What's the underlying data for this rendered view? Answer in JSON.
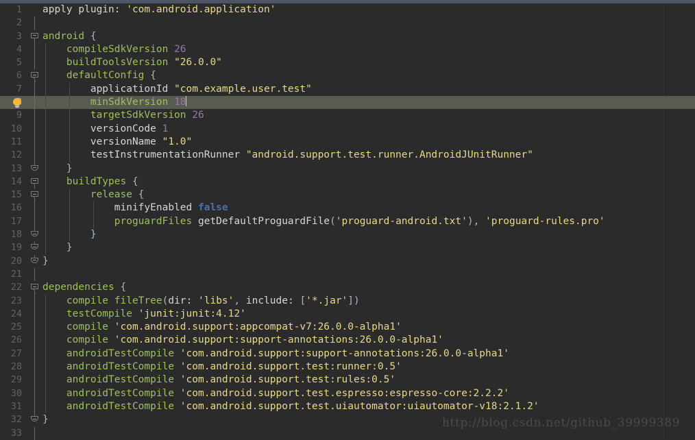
{
  "app": {
    "name": "android-studio-code-editor",
    "theme": "Darcula",
    "file_language": "Groovy / Gradle"
  },
  "colors": {
    "background": "#2b2b2b",
    "gutter_background": "#2b2b2b",
    "line_number": "#606366",
    "line_number_current": "#a4a4a4",
    "current_line_highlight": "#585b50",
    "top_strip": "#4e5665",
    "identifier_green": "#9fbf60",
    "string_yellow": "#e8d98a",
    "number_purple": "#9876aa",
    "keyword_blue": "#4b6eaf",
    "plain_text": "#a9b7c6",
    "white_text": "#d6d6d6",
    "fold_marker": "#7a7a78",
    "indent_guide": "#4a4a48",
    "bulb_yellow": "#f2b63c",
    "watermark": "#4a4a48",
    "margin_guide": "#323232"
  },
  "gutter": {
    "intention_bulb_line": 8,
    "intention_bulb_icon": "lightbulb-icon",
    "first_line": 1,
    "last_line": 33
  },
  "editor": {
    "current_line": 8,
    "caret_line": 8,
    "caret_column": 25
  },
  "watermark": {
    "text": "http://blog.csdn.net/github_39999389"
  },
  "lines": [
    {
      "n": 1,
      "fold": "none",
      "indent_guides": [],
      "tokens": [
        {
          "t": "apply plugin: ",
          "c": "t-white"
        },
        {
          "t": "'com.android.application'",
          "c": "t-str"
        }
      ]
    },
    {
      "n": 2,
      "fold": "rail",
      "indent_guides": [],
      "tokens": []
    },
    {
      "n": 3,
      "fold": "open",
      "indent_guides": [],
      "tokens": [
        {
          "t": "android",
          "c": "t-ident"
        },
        {
          "t": " {",
          "c": "t-brace"
        }
      ]
    },
    {
      "n": 4,
      "fold": "rail",
      "indent_guides": [
        0
      ],
      "tokens": [
        {
          "t": "    compileSdkVersion ",
          "c": "t-ident"
        },
        {
          "t": "26",
          "c": "t-num"
        }
      ]
    },
    {
      "n": 5,
      "fold": "rail",
      "indent_guides": [
        0
      ],
      "tokens": [
        {
          "t": "    buildToolsVersion ",
          "c": "t-ident"
        },
        {
          "t": "\"26.0.0\"",
          "c": "t-str"
        }
      ]
    },
    {
      "n": 6,
      "fold": "open",
      "indent_guides": [
        0
      ],
      "tokens": [
        {
          "t": "    defaultConfig",
          "c": "t-ident"
        },
        {
          "t": " {",
          "c": "t-brace"
        }
      ]
    },
    {
      "n": 7,
      "fold": "rail",
      "indent_guides": [
        0,
        1
      ],
      "tokens": [
        {
          "t": "        applicationId ",
          "c": "t-white"
        },
        {
          "t": "\"com.example.user.test\"",
          "c": "t-str"
        }
      ]
    },
    {
      "n": 8,
      "fold": "rail",
      "current": true,
      "bulb": true,
      "indent_guides": [
        0,
        1
      ],
      "tokens": [
        {
          "t": "        minSdkVersion ",
          "c": "t-ident"
        },
        {
          "t": "18",
          "c": "t-num"
        }
      ],
      "caret": true
    },
    {
      "n": 9,
      "fold": "rail",
      "indent_guides": [
        0,
        1
      ],
      "tokens": [
        {
          "t": "        targetSdkVersion ",
          "c": "t-ident"
        },
        {
          "t": "26",
          "c": "t-num"
        }
      ]
    },
    {
      "n": 10,
      "fold": "rail",
      "indent_guides": [
        0,
        1
      ],
      "tokens": [
        {
          "t": "        versionCode ",
          "c": "t-white"
        },
        {
          "t": "1",
          "c": "t-num"
        }
      ]
    },
    {
      "n": 11,
      "fold": "rail",
      "indent_guides": [
        0,
        1
      ],
      "tokens": [
        {
          "t": "        versionName ",
          "c": "t-white"
        },
        {
          "t": "\"1.0\"",
          "c": "t-str"
        }
      ]
    },
    {
      "n": 12,
      "fold": "rail",
      "indent_guides": [
        0,
        1
      ],
      "tokens": [
        {
          "t": "        testInstrumentationRunner ",
          "c": "t-white"
        },
        {
          "t": "\"android.support.test.runner.AndroidJUnitRunner\"",
          "c": "t-str"
        }
      ]
    },
    {
      "n": 13,
      "fold": "close",
      "indent_guides": [
        0
      ],
      "tokens": [
        {
          "t": "    }",
          "c": "t-brace"
        }
      ]
    },
    {
      "n": 14,
      "fold": "open",
      "indent_guides": [
        0
      ],
      "tokens": [
        {
          "t": "    buildTypes",
          "c": "t-ident"
        },
        {
          "t": " {",
          "c": "t-brace"
        }
      ]
    },
    {
      "n": 15,
      "fold": "open",
      "indent_guides": [
        0,
        1
      ],
      "tokens": [
        {
          "t": "        release",
          "c": "t-ident"
        },
        {
          "t": " {",
          "c": "t-brace"
        }
      ]
    },
    {
      "n": 16,
      "fold": "rail",
      "indent_guides": [
        0,
        1,
        2
      ],
      "tokens": [
        {
          "t": "            minifyEnabled ",
          "c": "t-white"
        },
        {
          "t": "false",
          "c": "t-kw"
        }
      ]
    },
    {
      "n": 17,
      "fold": "rail",
      "indent_guides": [
        0,
        1,
        2
      ],
      "tokens": [
        {
          "t": "            proguardFiles ",
          "c": "t-ident"
        },
        {
          "t": "getDefaultProguardFile",
          "c": "t-white"
        },
        {
          "t": "(",
          "c": "t-punct"
        },
        {
          "t": "'proguard-android.txt'",
          "c": "t-str"
        },
        {
          "t": "), ",
          "c": "t-punct"
        },
        {
          "t": "'proguard-rules.pro'",
          "c": "t-str"
        }
      ]
    },
    {
      "n": 18,
      "fold": "close",
      "indent_guides": [
        0,
        1
      ],
      "tokens": [
        {
          "t": "        }",
          "c": "t-brace"
        }
      ]
    },
    {
      "n": 19,
      "fold": "close",
      "indent_guides": [
        0
      ],
      "tokens": [
        {
          "t": "    }",
          "c": "t-brace"
        }
      ]
    },
    {
      "n": 20,
      "fold": "close",
      "indent_guides": [],
      "tokens": [
        {
          "t": "}",
          "c": "t-brace"
        }
      ]
    },
    {
      "n": 21,
      "fold": "rail",
      "indent_guides": [],
      "tokens": []
    },
    {
      "n": 22,
      "fold": "open",
      "indent_guides": [],
      "tokens": [
        {
          "t": "dependencies",
          "c": "t-ident"
        },
        {
          "t": " {",
          "c": "t-brace"
        }
      ]
    },
    {
      "n": 23,
      "fold": "rail",
      "indent_guides": [
        0
      ],
      "tokens": [
        {
          "t": "    compile ",
          "c": "t-ident"
        },
        {
          "t": "fileTree",
          "c": "t-ident"
        },
        {
          "t": "(",
          "c": "t-punct"
        },
        {
          "t": "dir: ",
          "c": "t-white"
        },
        {
          "t": "'libs'",
          "c": "t-str"
        },
        {
          "t": ", ",
          "c": "t-punct"
        },
        {
          "t": "include: ",
          "c": "t-white"
        },
        {
          "t": "[",
          "c": "t-punct"
        },
        {
          "t": "'*.jar'",
          "c": "t-str"
        },
        {
          "t": "])",
          "c": "t-punct"
        }
      ]
    },
    {
      "n": 24,
      "fold": "rail",
      "indent_guides": [
        0
      ],
      "tokens": [
        {
          "t": "    testCompile ",
          "c": "t-ident"
        },
        {
          "t": "'junit:junit:4.12'",
          "c": "t-str"
        }
      ]
    },
    {
      "n": 25,
      "fold": "rail",
      "indent_guides": [
        0
      ],
      "tokens": [
        {
          "t": "    compile ",
          "c": "t-ident"
        },
        {
          "t": "'com.android.support:appcompat-v7:26.0.0-alpha1'",
          "c": "t-str"
        }
      ]
    },
    {
      "n": 26,
      "fold": "rail",
      "indent_guides": [
        0
      ],
      "tokens": [
        {
          "t": "    compile ",
          "c": "t-ident"
        },
        {
          "t": "'com.android.support:support-annotations:26.0.0-alpha1'",
          "c": "t-str"
        }
      ]
    },
    {
      "n": 27,
      "fold": "rail",
      "indent_guides": [
        0
      ],
      "tokens": [
        {
          "t": "    androidTestCompile ",
          "c": "t-ident"
        },
        {
          "t": "'com.android.support:support-annotations:26.0.0-alpha1'",
          "c": "t-str"
        }
      ]
    },
    {
      "n": 28,
      "fold": "rail",
      "indent_guides": [
        0
      ],
      "tokens": [
        {
          "t": "    androidTestCompile ",
          "c": "t-ident"
        },
        {
          "t": "'com.android.support.test:runner:0.5'",
          "c": "t-str"
        }
      ]
    },
    {
      "n": 29,
      "fold": "rail",
      "indent_guides": [
        0
      ],
      "tokens": [
        {
          "t": "    androidTestCompile ",
          "c": "t-ident"
        },
        {
          "t": "'com.android.support.test:rules:0.5'",
          "c": "t-str"
        }
      ]
    },
    {
      "n": 30,
      "fold": "rail",
      "indent_guides": [
        0
      ],
      "tokens": [
        {
          "t": "    androidTestCompile ",
          "c": "t-ident"
        },
        {
          "t": "'com.android.support.test.espresso:espresso-core:2.2.2'",
          "c": "t-str"
        }
      ]
    },
    {
      "n": 31,
      "fold": "rail",
      "indent_guides": [
        0
      ],
      "tokens": [
        {
          "t": "    androidTestCompile ",
          "c": "t-ident"
        },
        {
          "t": "'com.android.support.test.uiautomator:uiautomator-v18:2.1.2'",
          "c": "t-str"
        }
      ]
    },
    {
      "n": 32,
      "fold": "close",
      "indent_guides": [],
      "tokens": [
        {
          "t": "}",
          "c": "t-brace"
        }
      ]
    },
    {
      "n": 33,
      "fold": "rail",
      "indent_guides": [],
      "tokens": []
    }
  ]
}
